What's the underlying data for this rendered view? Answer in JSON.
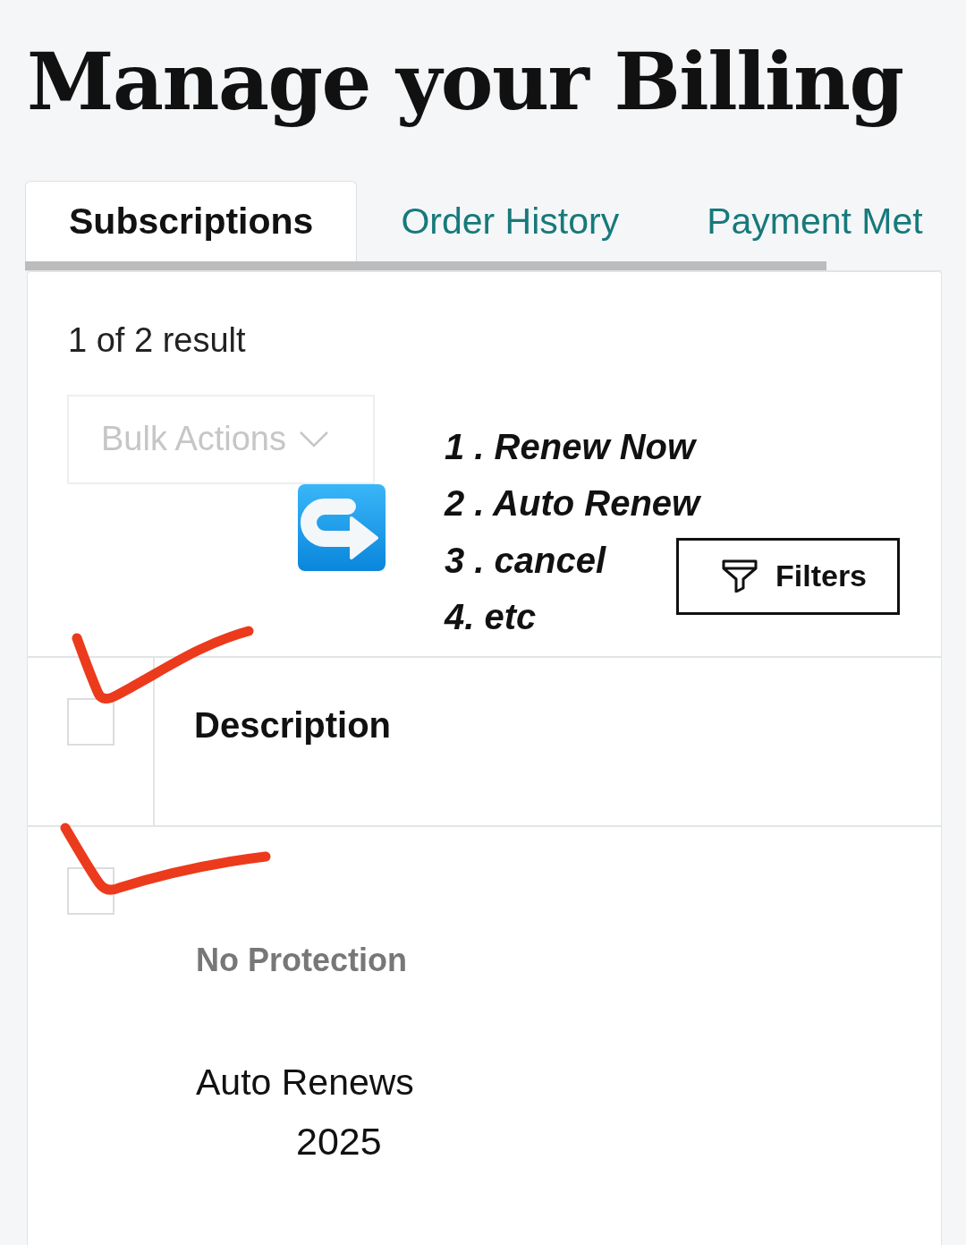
{
  "title": "Manage your Billing",
  "tabs": [
    {
      "label": "Subscriptions",
      "selected": true
    },
    {
      "label": "Order History",
      "selected": false
    },
    {
      "label": "Payment Met",
      "selected": false
    }
  ],
  "results": {
    "count_text": "1 of 2 result"
  },
  "bulk_actions": {
    "label": "Bulk Actions",
    "disabled": true
  },
  "annotation": {
    "items": [
      "1 . Renew Now",
      "2 . Auto Renew",
      "3 . cancel",
      "4. etc"
    ]
  },
  "filters_button": {
    "label": "Filters"
  },
  "table": {
    "header": {
      "checked": false,
      "hand_ticked": true,
      "column": "Description"
    },
    "rows": [
      {
        "checked": false,
        "hand_ticked": true,
        "protection": "No Protection",
        "renewal": "Auto Renews",
        "renewal_year": "2025"
      }
    ]
  }
}
